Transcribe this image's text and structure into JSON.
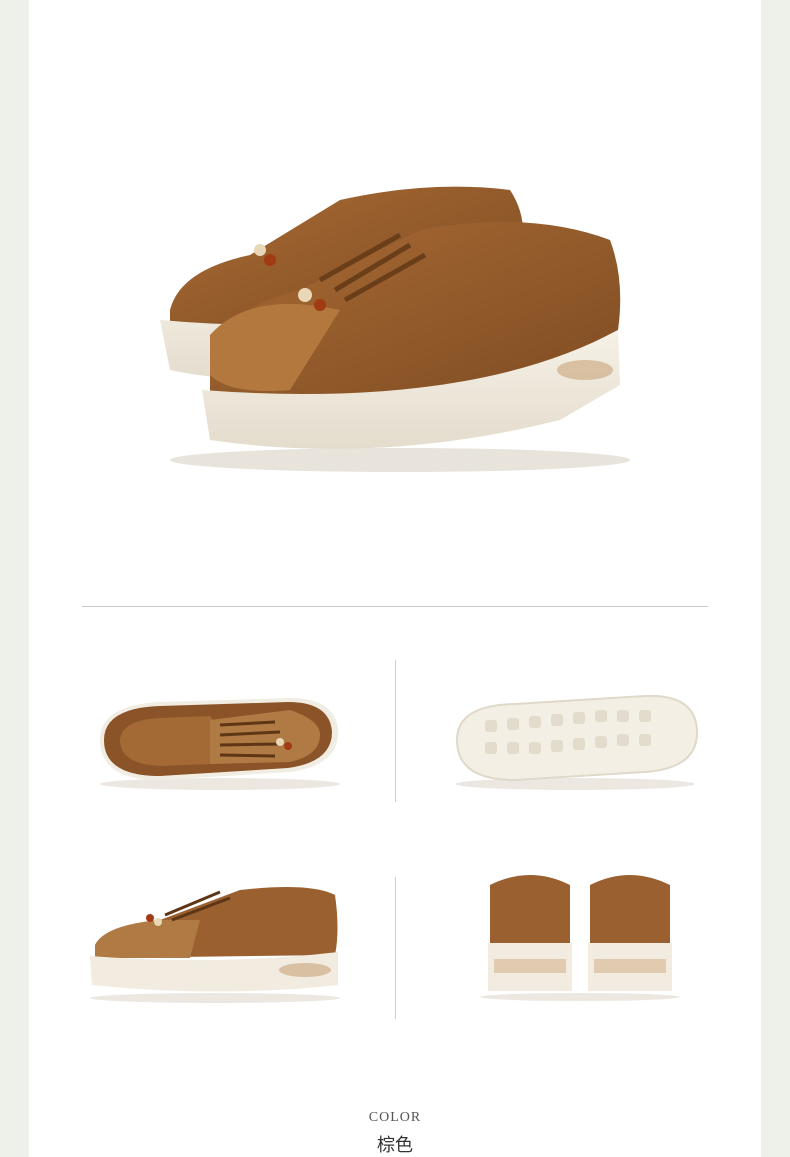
{
  "images": {
    "hero": "brown-platform-sneakers-pair-angle-view",
    "top_view": "sneaker-top-view",
    "sole_view": "sneaker-sole-view",
    "side_view": "sneaker-side-view",
    "back_view": "sneaker-pair-back-view"
  },
  "colors": {
    "leather": "#9a6030",
    "suede": "#b07640",
    "sole": "#efe9dd",
    "background": "#ffffff",
    "page_edge": "#eef0ea"
  },
  "color_section": {
    "label": "COLOR",
    "value": "棕色"
  }
}
